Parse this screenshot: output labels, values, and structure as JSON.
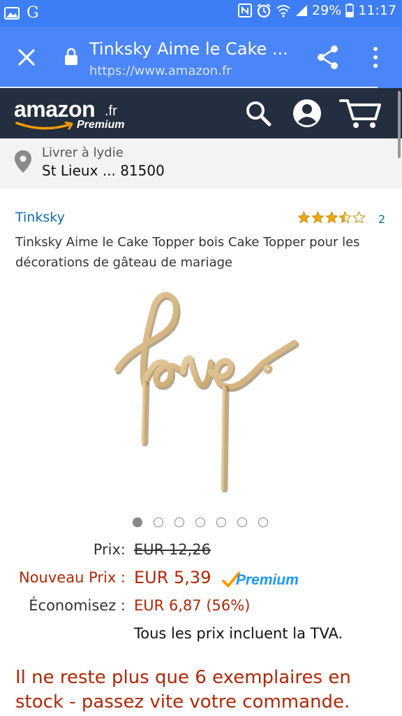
{
  "status_bar": {
    "left_icons": [
      "image-icon",
      "g-app-icon"
    ],
    "g_letter": "G",
    "right_icons": [
      "nfc-icon",
      "alarm-icon",
      "wifi-icon",
      "signal-icon",
      "battery-icon"
    ],
    "battery": "29%",
    "time": "11:17"
  },
  "browser": {
    "page_title": "Tinksky Aime le Cake ...",
    "url": "https://www.amazon.fr",
    "load_progress": 0.94,
    "toolbar_color": "#4a86f7"
  },
  "header": {
    "logo_text": "amazon",
    "logo_tld": ".fr",
    "logo_sub": "Premium",
    "icons": [
      "search-icon",
      "account-icon",
      "cart-icon"
    ],
    "bg_color": "#232f3e"
  },
  "delivery": {
    "label": "Livrer à lydie",
    "address": "St Lieux ... 81500"
  },
  "product": {
    "brand": "Tinksky",
    "rating": 3.5,
    "rating_max": 5,
    "rating_count": "2",
    "title": "Tinksky Aime le Cake Topper bois Cake Topper pour les décorations de gâteau de mariage",
    "image_text": "love",
    "image_count": 7,
    "active_image": 0
  },
  "pricing": {
    "price_label": "Prix:",
    "price_value": "EUR 12,26",
    "new_price_label": "Nouveau Prix :",
    "new_price_value": "EUR 5,39",
    "premium_badge": "Premium",
    "savings_label": "Économisez :",
    "savings_value": "EUR 6,87 (56%)",
    "vat_note": "Tous les prix incluent la TVA."
  },
  "stock_message": "Il ne reste plus que 6 exemplaires en stock - passez vite votre commande.",
  "colors": {
    "accent_red": "#b12704",
    "link_blue": "#0f6dac",
    "prime_blue": "#1a98ff",
    "star_gold": "#f0a80e"
  }
}
